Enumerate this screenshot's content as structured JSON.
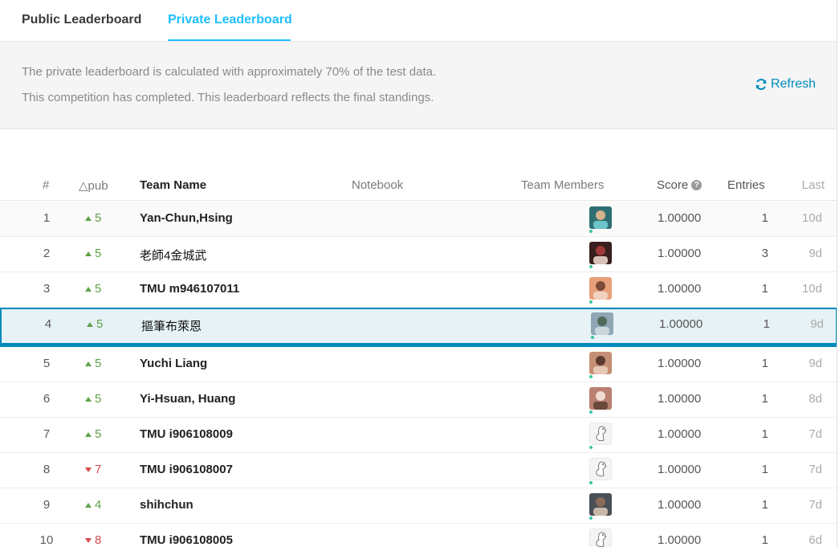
{
  "tabs": {
    "public_label": "Public Leaderboard",
    "private_label": "Private Leaderboard",
    "active": "private"
  },
  "info": {
    "line1": "The private leaderboard is calculated with approximately 70% of the test data.",
    "line2": "This competition has completed. This leaderboard reflects the final standings.",
    "refresh_label": "Refresh",
    "refresh_icon": "refresh-icon"
  },
  "table": {
    "headers": {
      "rank": "#",
      "delta": "△pub",
      "team": "Team Name",
      "notebook": "Notebook",
      "members": "Team Members",
      "score": "Score",
      "entries": "Entries",
      "last": "Last"
    },
    "rows": [
      {
        "rank": "1",
        "direction": "up",
        "delta": "5",
        "team": "Yan-Chun,Hsing",
        "score": "1.00000",
        "entries": "1",
        "last": "10d",
        "avatar": "photo-avatar"
      },
      {
        "rank": "2",
        "direction": "up",
        "delta": "5",
        "team": "老師4金城武",
        "score": "1.00000",
        "entries": "3",
        "last": "9d",
        "avatar": "photo-avatar"
      },
      {
        "rank": "3",
        "direction": "up",
        "delta": "5",
        "team": "TMU m946107011",
        "score": "1.00000",
        "entries": "1",
        "last": "10d",
        "avatar": "photo-avatar"
      },
      {
        "rank": "4",
        "direction": "up",
        "delta": "5",
        "team": "摳筆布萊恩",
        "score": "1.00000",
        "entries": "1",
        "last": "9d",
        "avatar": "photo-avatar"
      },
      {
        "rank": "5",
        "direction": "up",
        "delta": "5",
        "team": "Yuchi Liang",
        "score": "1.00000",
        "entries": "1",
        "last": "9d",
        "avatar": "photo-avatar"
      },
      {
        "rank": "6",
        "direction": "up",
        "delta": "5",
        "team": "Yi-Hsuan, Huang",
        "score": "1.00000",
        "entries": "1",
        "last": "8d",
        "avatar": "photo-avatar"
      },
      {
        "rank": "7",
        "direction": "up",
        "delta": "5",
        "team": "TMU i906108009",
        "score": "1.00000",
        "entries": "1",
        "last": "7d",
        "avatar": "goose-avatar"
      },
      {
        "rank": "8",
        "direction": "down",
        "delta": "7",
        "team": "TMU i906108007",
        "score": "1.00000",
        "entries": "1",
        "last": "7d",
        "avatar": "goose-avatar"
      },
      {
        "rank": "9",
        "direction": "up",
        "delta": "4",
        "team": "shihchun",
        "score": "1.00000",
        "entries": "1",
        "last": "7d",
        "avatar": "photo-avatar"
      },
      {
        "rank": "10",
        "direction": "down",
        "delta": "8",
        "team": "TMU i906108005",
        "score": "1.00000",
        "entries": "1",
        "last": "6d",
        "avatar": "goose-avatar"
      }
    ]
  },
  "colors": {
    "accent": "#20beff",
    "link": "#008abc",
    "up": "#5fa247",
    "down": "#d64b4b",
    "highlight_bg": "#e6f2f6"
  }
}
